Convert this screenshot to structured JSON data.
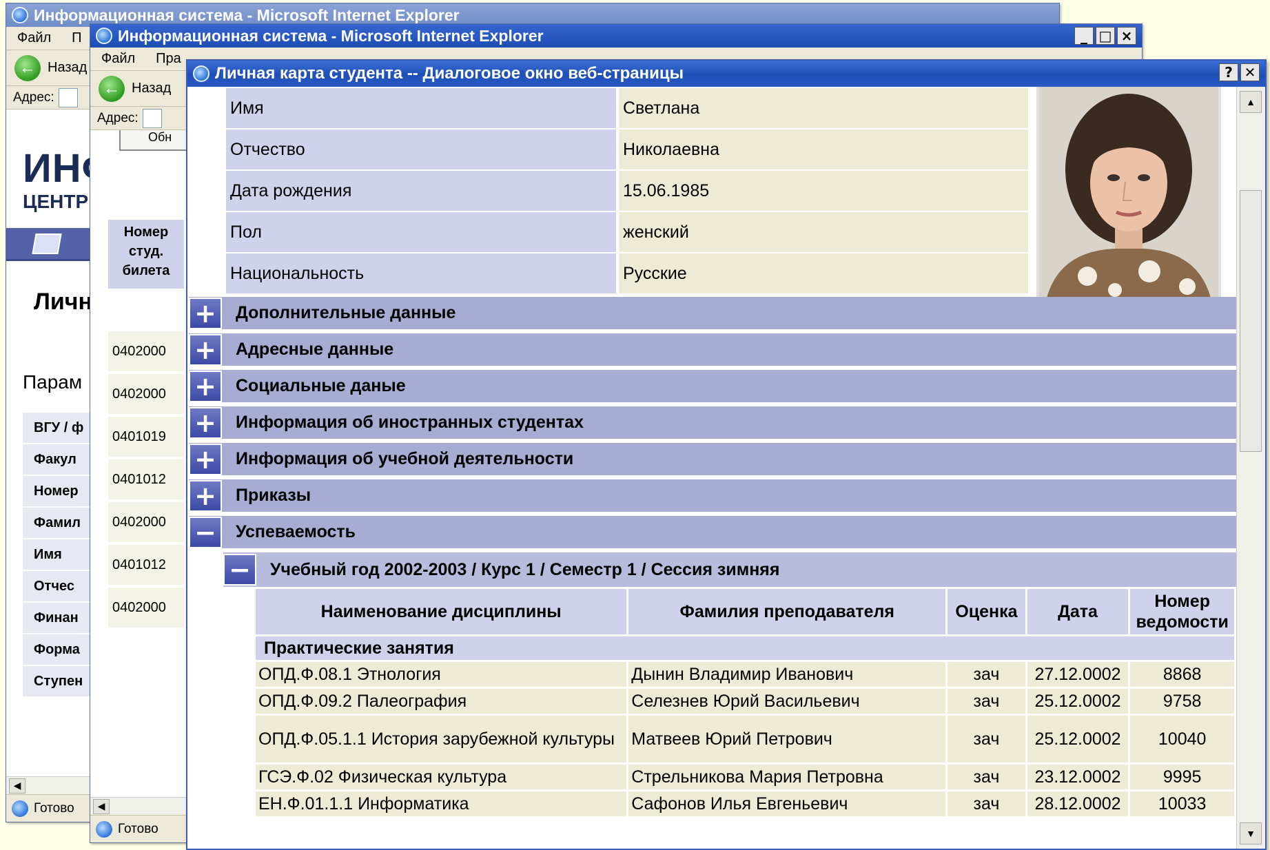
{
  "back_window_1": {
    "title": "Информационная система - Microsoft Internet Explorer",
    "menu": [
      "Файл",
      "П"
    ],
    "back_label": "Назад",
    "address_label": "Адрес:",
    "logo_line1": "ИНФ",
    "logo_line2": "ЦЕНТР",
    "page_heading": "Личн",
    "params_heading": "Парам",
    "fields": [
      "ВГУ / ф",
      "Факул",
      "Номер",
      "Фамил",
      "Имя",
      "Отчес",
      "Финан",
      "Форма",
      "Ступен"
    ],
    "status": "Готово"
  },
  "back_window_2": {
    "title": "Информационная система - Microsoft Internet Explorer",
    "menu": [
      "Файл",
      "Пра"
    ],
    "back_label": "Назад",
    "address_label": "Адрес:",
    "refresh_button": "Обн",
    "column_header": "Номер студ. билета",
    "ticket_numbers": [
      "0402000",
      "0402000",
      "0401019",
      "0401012",
      "0402000",
      "0401012",
      "0402000"
    ],
    "status": "Готово"
  },
  "dialog": {
    "title": "Личная карта студента -- Диалоговое окно веб-страницы",
    "help_button": "?",
    "close_button": "✕",
    "personal": [
      {
        "label": "Имя",
        "value": "Светлана"
      },
      {
        "label": "Отчество",
        "value": "Николаевна"
      },
      {
        "label": "Дата рождения",
        "value": "15.06.1985"
      },
      {
        "label": "Пол",
        "value": "женский"
      },
      {
        "label": "Национальность",
        "value": "Русские"
      }
    ],
    "sections": [
      {
        "label": "Дополнительные данные",
        "state": "+"
      },
      {
        "label": "Адресные данные",
        "state": "+"
      },
      {
        "label": "Социальные даные",
        "state": "+"
      },
      {
        "label": "Информация об иностранных студентах",
        "state": "+"
      },
      {
        "label": "Информация об учебной деятельности",
        "state": "+"
      },
      {
        "label": "Приказы",
        "state": "+"
      },
      {
        "label": "Успеваемость",
        "state": "−"
      }
    ],
    "subsection": {
      "label": "Учебный год 2002-2003 / Курс 1 / Семестр 1 / Сессия зимняя",
      "state": "−"
    },
    "table": {
      "headers": [
        "Наименование дисциплины",
        "Фамилия преподавателя",
        "Оценка",
        "Дата",
        "Номер ведомости"
      ],
      "category": "Практические занятия",
      "rows": [
        [
          "ОПД.Ф.08.1 Этнология",
          "Дынин Владимир Иванович",
          "зач",
          "27.12.0002",
          "8868"
        ],
        [
          "ОПД.Ф.09.2 Палеография",
          "Селезнев Юрий Васильевич",
          "зач",
          "25.12.0002",
          "9758"
        ],
        [
          "ОПД.Ф.05.1.1 История зарубежной культуры",
          "Матвеев Юрий Петрович",
          "зач",
          "25.12.0002",
          "10040"
        ],
        [
          "ГСЭ.Ф.02 Физическая культура",
          "Стрельникова Мария Петровна",
          "зач",
          "23.12.0002",
          "9995"
        ],
        [
          "ЕН.Ф.01.1.1 Информатика",
          "Сафонов Илья Евгеньевич",
          "зач",
          "28.12.0002",
          "10033"
        ]
      ]
    }
  }
}
